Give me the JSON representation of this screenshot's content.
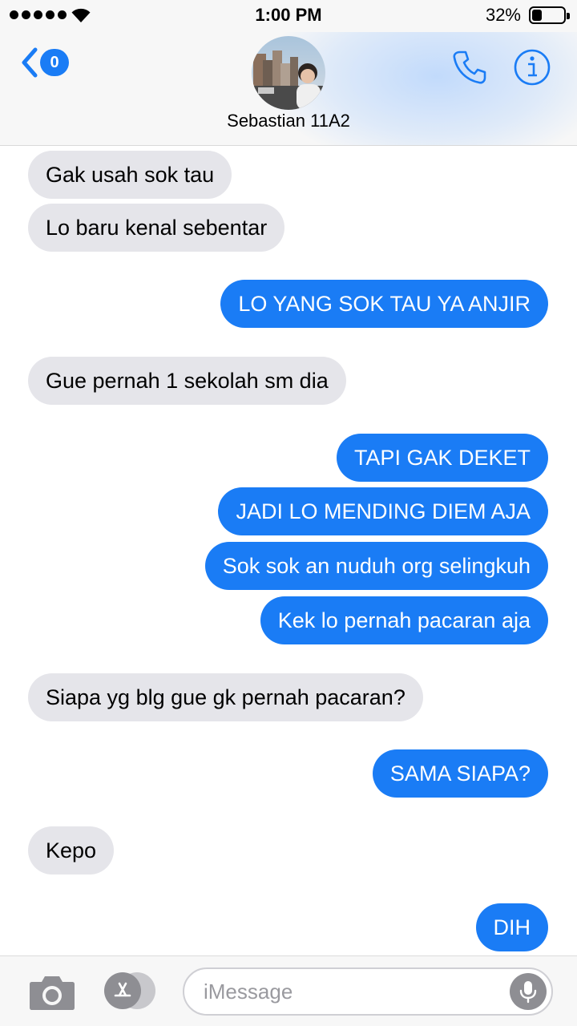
{
  "status_bar": {
    "time": "1:00 PM",
    "battery_percent": "32%",
    "battery_level": 0.32,
    "signal_bars": 5
  },
  "header": {
    "back_badge_count": "0",
    "contact_name": "Sebastian 11A2",
    "accent_color": "#1a7cf5"
  },
  "messages": [
    {
      "side": "incoming",
      "text": "Gak usah sok tau"
    },
    {
      "side": "incoming",
      "text": "Lo baru kenal sebentar"
    },
    {
      "side": "outgoing",
      "text": "LO YANG SOK TAU YA ANJIR"
    },
    {
      "side": "incoming",
      "text": "Gue pernah 1 sekolah sm dia"
    },
    {
      "side": "outgoing",
      "text": "TAPI GAK DEKET"
    },
    {
      "side": "outgoing",
      "text": "JADI LO MENDING DIEM AJA"
    },
    {
      "side": "outgoing",
      "text": "Sok sok an nuduh org selingkuh"
    },
    {
      "side": "outgoing",
      "text": "Kek lo pernah pacaran aja"
    },
    {
      "side": "incoming",
      "text": "Siapa yg blg gue gk pernah pacaran?"
    },
    {
      "side": "outgoing",
      "text": "SAMA SIAPA?"
    },
    {
      "side": "incoming",
      "text": "Kepo"
    },
    {
      "side": "outgoing",
      "text": "DIH"
    }
  ],
  "input_bar": {
    "placeholder": "iMessage",
    "value": ""
  },
  "icons": {
    "back": "chevron-left-icon",
    "call": "phone-icon",
    "details": "info-icon",
    "camera": "camera-icon",
    "apps": "app-store-icon",
    "dictation": "microphone-icon"
  }
}
